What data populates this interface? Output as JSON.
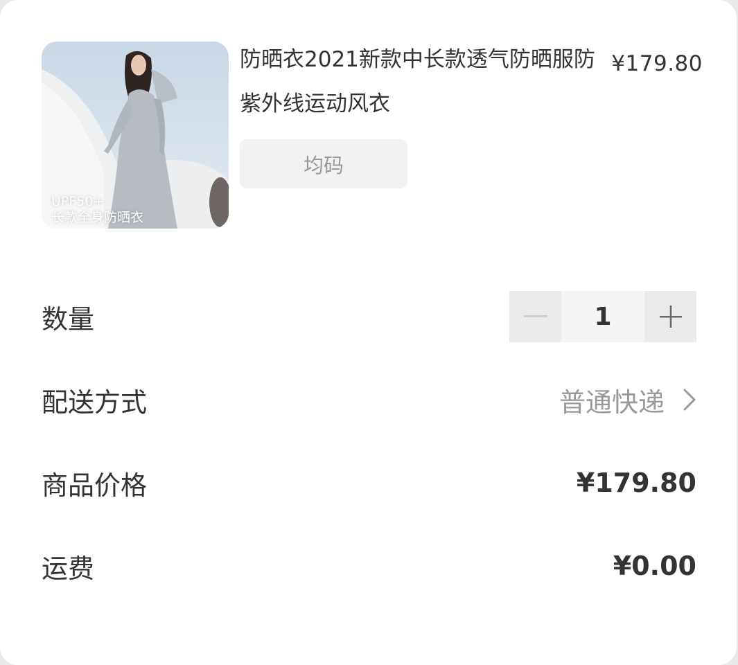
{
  "product": {
    "title": "防晒衣2021新款中长款透气防晒服防紫外线运动风衣",
    "price": "¥179.80",
    "spec": "均码",
    "image_caption_line1": "UPF50+",
    "image_caption_line2": "长款全身防晒衣"
  },
  "quantity": {
    "label": "数量",
    "value": "1",
    "decrement_icon": "minus-icon",
    "increment_icon": "plus-icon"
  },
  "shipping": {
    "label": "配送方式",
    "value": "普通快递",
    "icon": "chevron-right-icon"
  },
  "goods_price": {
    "label": "商品价格",
    "value": "¥179.80"
  },
  "freight": {
    "label": "运费",
    "value": "¥0.00"
  },
  "colors": {
    "text_primary": "#333333",
    "text_muted": "#999999",
    "stepper_button_bg": "#ebebeb",
    "stepper_value_bg": "#f5f5f5",
    "tag_bg": "#f2f2f2"
  }
}
